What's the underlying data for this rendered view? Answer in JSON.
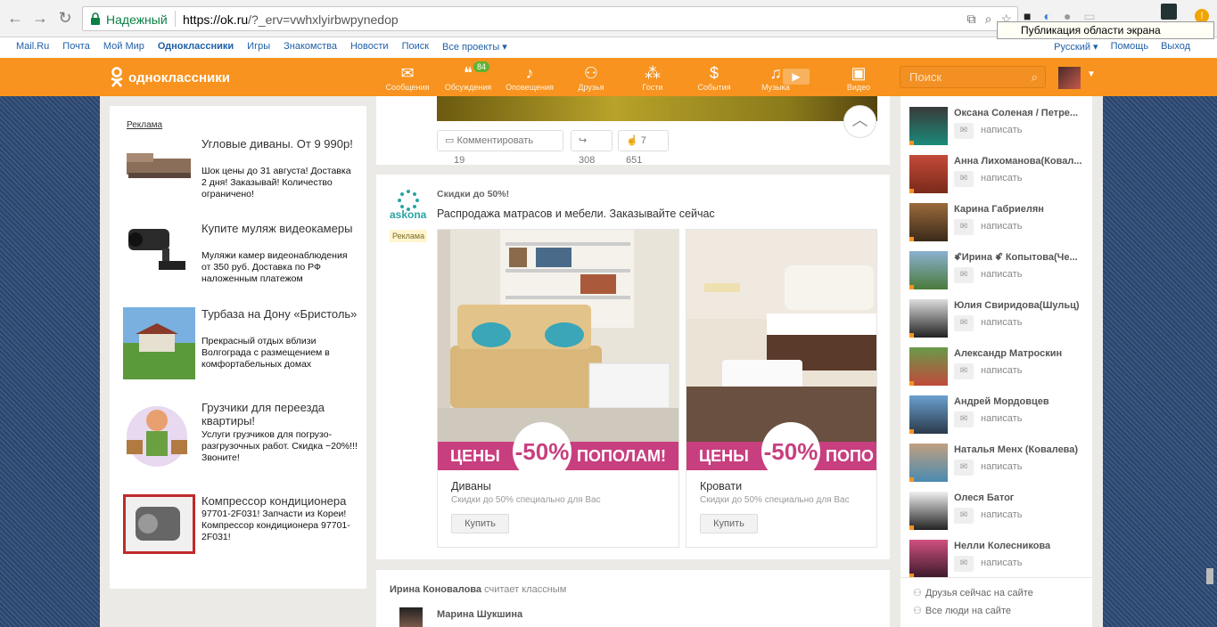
{
  "browser": {
    "secure_label": "Надежный",
    "url_host": "https://ok.ru",
    "url_path": "/?_erv=vwhxlyirbwpynedop",
    "tooltip": "Публикация области экрана"
  },
  "portal": {
    "links": [
      "Mail.Ru",
      "Почта",
      "Мой Мир",
      "Одноклассники",
      "Игры",
      "Знакомства",
      "Новости",
      "Поиск",
      "Все проекты ▾"
    ],
    "language": "Русский ▾",
    "help": "Помощь",
    "logout": "Выход"
  },
  "topbar": {
    "logo": "одноклассники",
    "items": [
      {
        "label": "Сообщения",
        "icon": "envelope-icon",
        "glyph": "✉"
      },
      {
        "label": "Обсуждения",
        "icon": "chat-bubbles-icon",
        "glyph": "💬",
        "badge": "84"
      },
      {
        "label": "Оповещения",
        "icon": "bell-icon",
        "glyph": "🔔"
      },
      {
        "label": "Друзья",
        "icon": "friends-icon",
        "glyph": "👥"
      },
      {
        "label": "Гости",
        "icon": "footprints-icon",
        "glyph": "👣"
      },
      {
        "label": "События",
        "icon": "events-icon",
        "glyph": "$"
      },
      {
        "label": "Музыка",
        "icon": "music-note-icon",
        "glyph": "♫"
      },
      {
        "label": "Видео",
        "icon": "video-camera-icon",
        "glyph": "🎥"
      }
    ],
    "search_placeholder": "Поиск"
  },
  "ads": {
    "label": "Реклама",
    "items": [
      {
        "title": "Угловые диваны. От 9 990р!",
        "text": "Шок цены до 31 августа! Доставка 2 дня! Заказывай! Количество ограничено!"
      },
      {
        "title": "Купите муляж видеокамеры",
        "text": "Муляжи камер видеонаблюдения от 350 руб. Доставка по РФ наложенным платежом"
      },
      {
        "title": "Турбаза на Дону «Бристоль»",
        "text": "Прекрасный отдых вблизи Волгограда с размещением в комфортабельных домах"
      },
      {
        "title": "Грузчики для переезда квартиры!",
        "text": "Услуги грузчиков для погрузо-разгрузочных работ. Скидка −20%!!! Звоните!"
      },
      {
        "title": "Компрессор кондиционера",
        "text": "97701-2F031! Запчасти из Кореи! Компрессор кондиционера 97701-2F031!"
      }
    ]
  },
  "post_top": {
    "comment_label": "Комментировать",
    "comment_count": "19",
    "shares": "308",
    "likes": "7 651"
  },
  "ad_post": {
    "brand": "askona",
    "tag": "Реклама",
    "subtitle": "Скидки до 50%!",
    "title": "Распродажа матрасов и мебели. Заказывайте сейчас",
    "cards": [
      {
        "promo_left": "ЦЕНЫ",
        "promo_pct": "-50%",
        "promo_right": "ПОПОЛАМ!",
        "name": "Диваны",
        "desc": "Скидки до 50% специально для Вас",
        "button": "Купить"
      },
      {
        "promo_left": "ЦЕНЫ",
        "promo_pct": "-50%",
        "promo_right": "ПОПО",
        "name": "Кровати",
        "desc": "Скидки до 50% специально для Вас",
        "button": "Купить"
      }
    ]
  },
  "next_post": {
    "author": "Ирина Коновалова",
    "action": "считает классным",
    "subject": "Марина Шукшина"
  },
  "friends": {
    "write_label": "написать",
    "list": [
      "Оксана Соленая / Петре...",
      "Анна Лихоманова(Ковал...",
      "Карина Габриелян",
      "ꗄИрина ꗄ Копытова(Че...",
      "Юлия Свиридова(Шульц)",
      "Александр Матроскин",
      "Андрей Мордовцев",
      "Наталья Менх (Ковалева)",
      "Олеся Батог",
      "Нелли Колесникова"
    ],
    "online_now": "Друзья сейчас на сайте",
    "all_people": "Все люди на сайте"
  }
}
